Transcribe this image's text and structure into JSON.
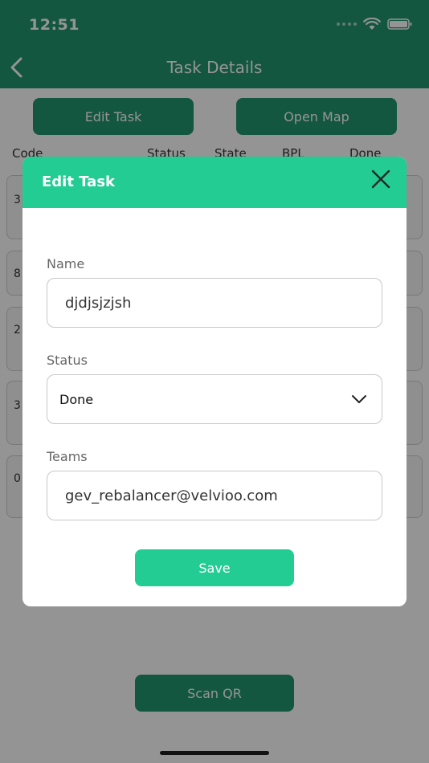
{
  "status_bar": {
    "time": "12:51"
  },
  "nav": {
    "title": "Task Details"
  },
  "actions": {
    "edit_task": "Edit Task",
    "open_map": "Open Map",
    "scan_qr": "Scan QR"
  },
  "table": {
    "columns": [
      "Code",
      "Status",
      "State",
      "BPL",
      "Done"
    ],
    "rows": [
      {
        "code": "3"
      },
      {
        "code": "8"
      },
      {
        "code": "2"
      },
      {
        "code": "3"
      },
      {
        "code": "0"
      }
    ]
  },
  "modal": {
    "title": "Edit Task",
    "name_label": "Name",
    "name_value": "djdjsjzjsh",
    "status_label": "Status",
    "status_value": "Done",
    "teams_label": "Teams",
    "teams_value": "gev_rebalancer@velvioo.com",
    "save_label": "Save"
  },
  "colors": {
    "header_green": "#22966e",
    "modal_accent": "#22cc93",
    "overlay": "rgba(0,0,0,0.42)"
  },
  "icons": {
    "back": "chevron-left-icon",
    "close": "close-icon",
    "dropdown": "chevron-down-icon",
    "wifi": "wifi-icon",
    "battery": "battery-icon"
  }
}
